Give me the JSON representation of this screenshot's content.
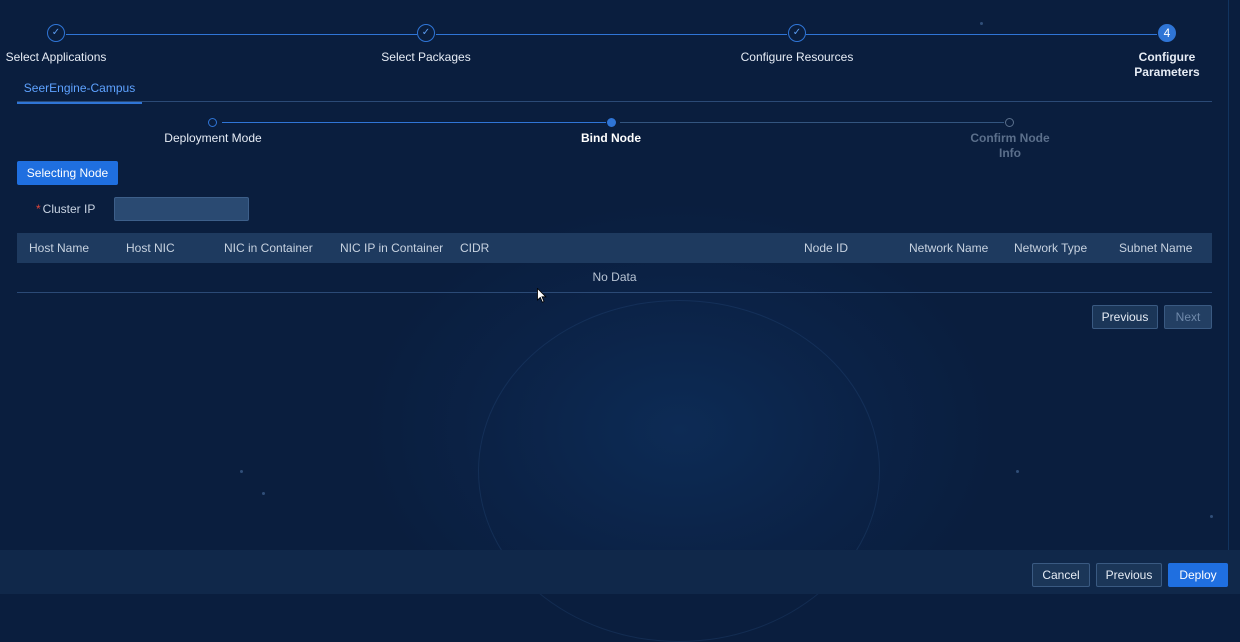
{
  "wizard": {
    "steps": [
      {
        "label": "Select Applications",
        "state": "done"
      },
      {
        "label": "Select Packages",
        "state": "done"
      },
      {
        "label": "Configure Resources",
        "state": "done"
      },
      {
        "label": "Configure Parameters",
        "state": "active",
        "number": "4"
      }
    ]
  },
  "tab": {
    "label": "SeerEngine-Campus"
  },
  "sub_steps": [
    {
      "label": "Deployment Mode",
      "state": "done"
    },
    {
      "label": "Bind Node",
      "state": "active"
    },
    {
      "label": "Confirm Node Info",
      "state": "pending"
    }
  ],
  "selecting_node_button": "Selecting Node",
  "cluster_ip": {
    "label": "Cluster IP",
    "required_mark": "*",
    "value": ""
  },
  "table": {
    "columns": [
      "Host Name",
      "Host NIC",
      "NIC in Container",
      "NIC IP in Container",
      "CIDR",
      "Node ID",
      "Network Name",
      "Network Type",
      "Subnet Name"
    ],
    "empty_text": "No Data"
  },
  "pagination": {
    "previous": "Previous",
    "next": "Next"
  },
  "footer": {
    "cancel": "Cancel",
    "previous": "Previous",
    "deploy": "Deploy"
  },
  "colors": {
    "accent": "#1f6fe0",
    "background": "#0b2246",
    "required": "#e0463b"
  },
  "icons": {
    "done_step": "check-icon",
    "cursor": "mouse-pointer-icon"
  }
}
